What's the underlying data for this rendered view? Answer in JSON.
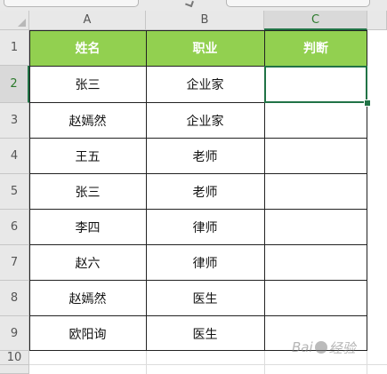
{
  "columns": [
    "A",
    "B",
    "C"
  ],
  "rows": [
    "1",
    "2",
    "3",
    "4",
    "5",
    "6",
    "7",
    "8",
    "9",
    "10"
  ],
  "selected_cell": "C2",
  "header": [
    "姓名",
    "职业",
    "判断"
  ],
  "data": [
    [
      "张三",
      "企业家",
      ""
    ],
    [
      "赵嫣然",
      "企业家",
      ""
    ],
    [
      "王五",
      "老师",
      ""
    ],
    [
      "张三",
      "老师",
      ""
    ],
    [
      "李四",
      "律师",
      ""
    ],
    [
      "赵六",
      "律师",
      ""
    ],
    [
      "赵嫣然",
      "医生",
      ""
    ],
    [
      "欧阳询",
      "医生",
      ""
    ]
  ],
  "colors": {
    "header_fill": "#92d050",
    "header_text": "#ffffff",
    "selection": "#217346"
  },
  "watermark": {
    "text_prefix": "Bai",
    "text_suffix": "经验"
  }
}
